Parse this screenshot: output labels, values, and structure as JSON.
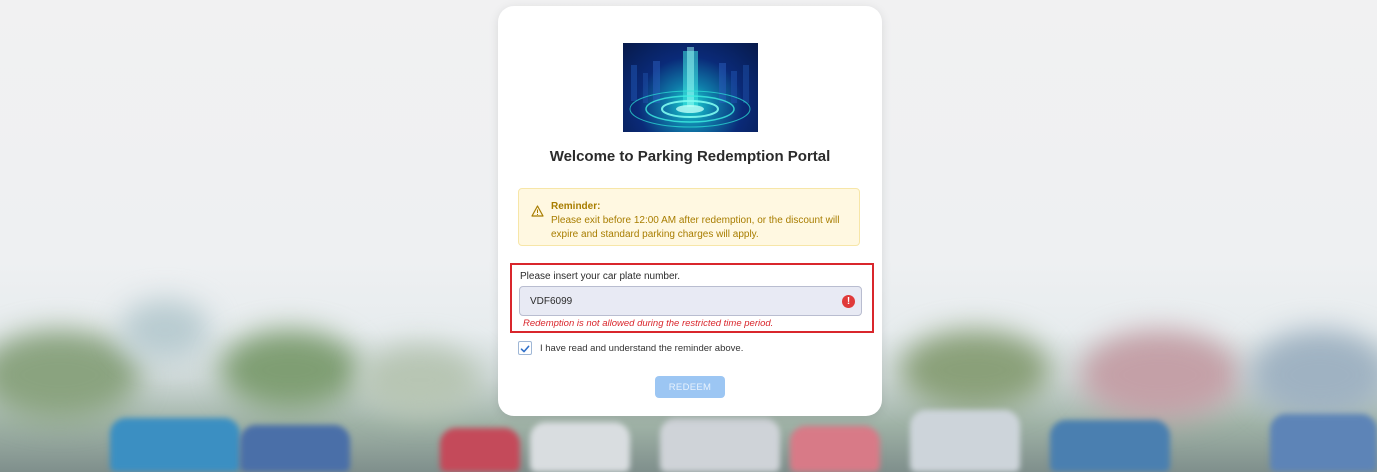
{
  "page": {
    "title": "Welcome to Parking Redemption Portal"
  },
  "reminder": {
    "heading": "Reminder:",
    "text": "Please exit before 12:00 AM after redemption, or the discount will expire and standard parking charges will apply.",
    "icon": "warning-icon"
  },
  "plate_field": {
    "label": "Please insert your car plate number.",
    "value": "VDF6099",
    "error_icon": "error-icon",
    "error_message": "Redemption is not allowed during the restricted time period."
  },
  "agreement": {
    "checked": true,
    "label": "I have read and understand the reminder above."
  },
  "actions": {
    "redeem_label": "REDEEM"
  },
  "colors": {
    "accent_blue": "#9cc6f3",
    "error_red": "#d9262c",
    "reminder_bg": "#fff8e1",
    "reminder_text": "#a87d00"
  }
}
